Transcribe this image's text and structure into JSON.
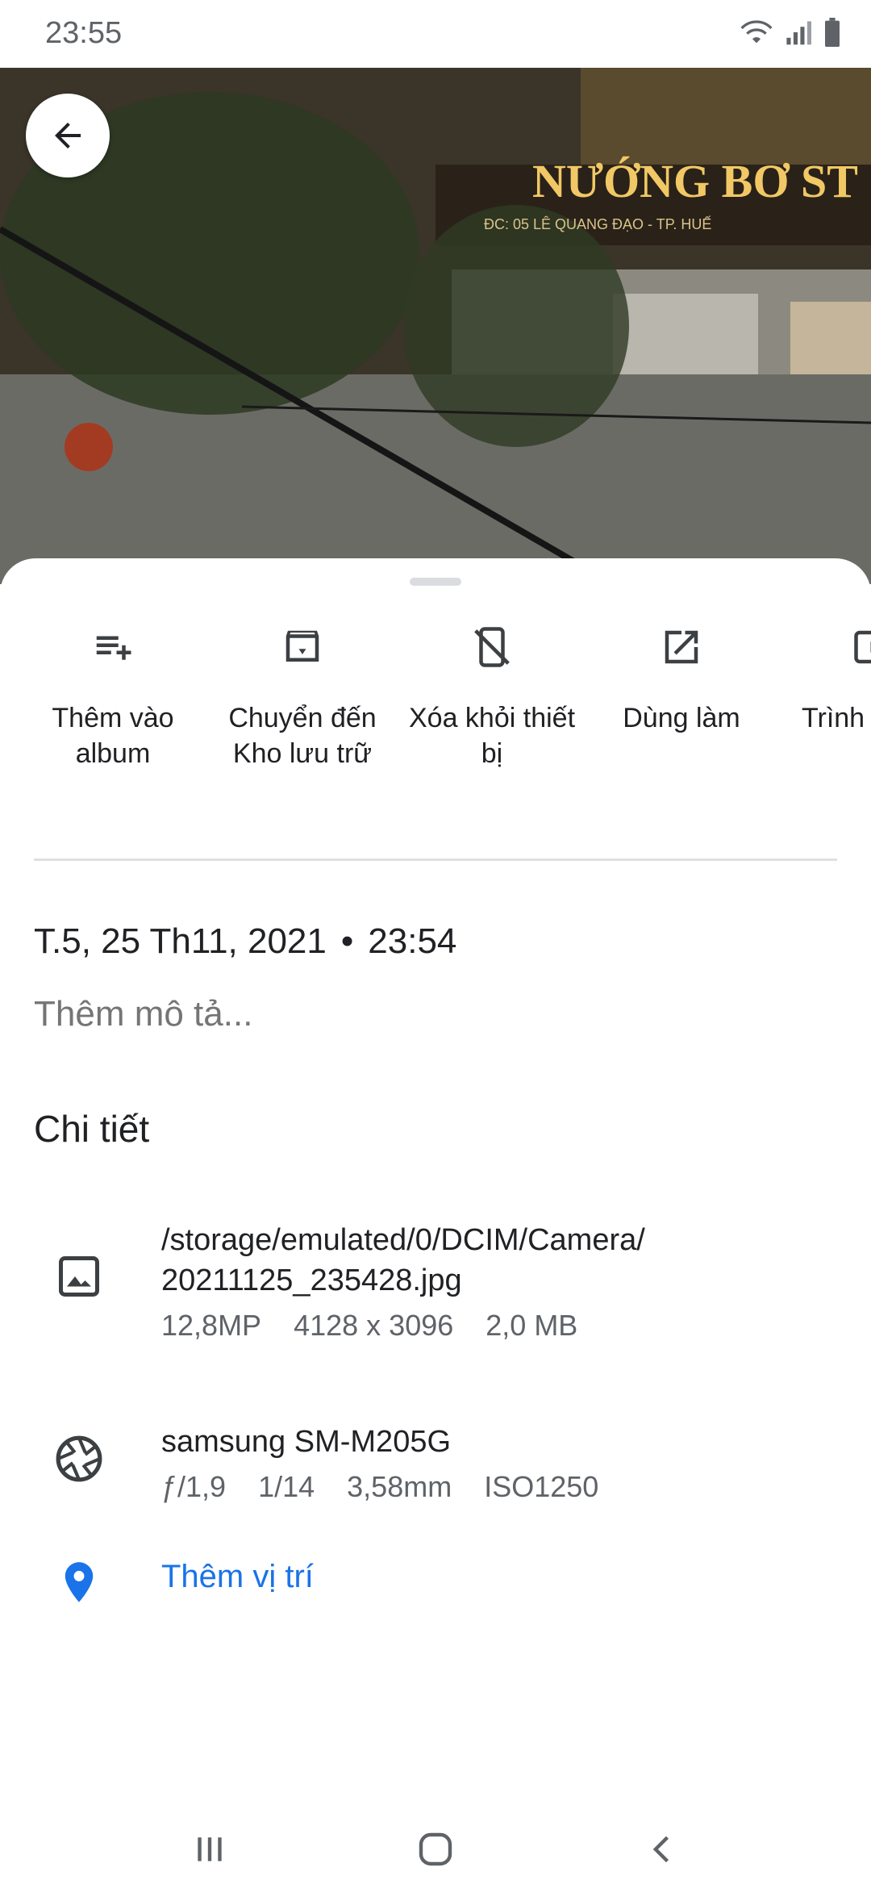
{
  "status_bar": {
    "time": "23:55"
  },
  "actions": [
    {
      "label": "Thêm vào album",
      "icon": "playlist-add-icon"
    },
    {
      "label": "Chuyển đến Kho lưu trữ",
      "icon": "archive-icon"
    },
    {
      "label": "Xóa khỏi thiết bị",
      "icon": "phone-off-icon"
    },
    {
      "label": "Dùng làm",
      "icon": "open-in-new-icon"
    },
    {
      "label": "Trình",
      "icon": "slideshow-icon"
    }
  ],
  "info": {
    "date": "T.5, 25 Th11, 2021",
    "separator": "•",
    "time": "23:54",
    "description_placeholder": "Thêm mô tả..."
  },
  "details": {
    "title": "Chi tiết",
    "file": {
      "path_line1": "/storage/emulated/0/DCIM/Camera/",
      "path_line2": "20211125_235428.jpg",
      "megapixels": "12,8MP",
      "resolution": "4128 x 3096",
      "size": "2,0 MB"
    },
    "camera": {
      "model": "samsung SM-M205G",
      "aperture": "ƒ/1,9",
      "shutter": "1/14",
      "focal": "3,58mm",
      "iso": "ISO1250"
    },
    "location": {
      "label": "Thêm vị trí"
    }
  },
  "photo": {
    "sign_text": "NƯỚNG BƠ ST",
    "sign_sub": "ĐC: 05 LÊ QUANG ĐẠO - TP. HUẾ"
  },
  "colors": {
    "accent": "#1a73e8",
    "icon": "#3c4043"
  }
}
